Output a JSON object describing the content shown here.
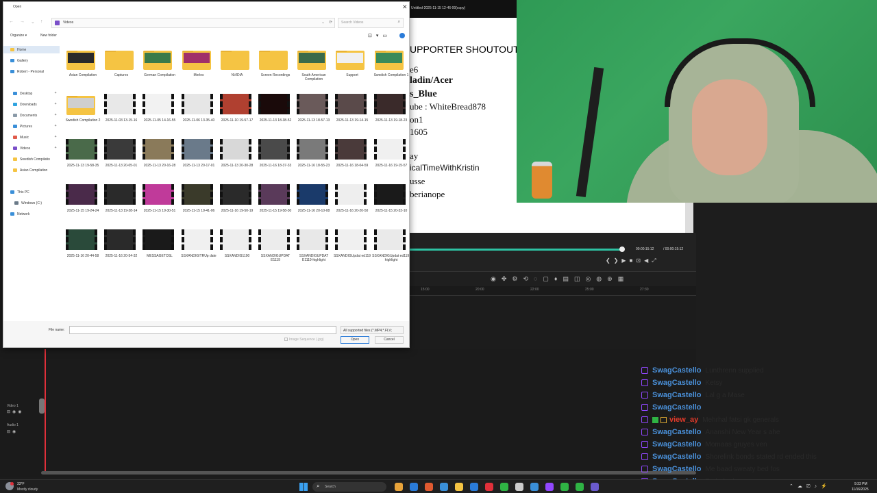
{
  "editor": {
    "title": "Untitled-2025-11-15 12-46-00(copy)",
    "timecode_current": "00:00:15:12",
    "timecode_total": "/ 00:00:15:12",
    "ruler_labels": [
      "15:00",
      "20:00",
      "22:00",
      "25:00",
      "27:30"
    ],
    "tracks": {
      "video": "Video 1",
      "audio": "Audio 1"
    }
  },
  "preview": {
    "title": "UPPORTER SHOUTOUT!",
    "lines": [
      "e6",
      "ladin/Acer",
      "s_Blue",
      "ube : WhiteBread878",
      "on1",
      "1605",
      "ay",
      "icalTimeWithKristin",
      "usse",
      "berianope"
    ]
  },
  "chat": {
    "user_color": "#4a90d9",
    "messages": [
      {
        "user": "SwagCastello",
        "text": "Lunthrenn supplied",
        "color": "#4a90d9"
      },
      {
        "user": "SwagCastello",
        "text": "Ketsy",
        "color": "#4a90d9"
      },
      {
        "user": "SwagCastello",
        "text": "Lal g a Mase",
        "color": "#4a90d9"
      },
      {
        "user": "SwagCastello",
        "text": "",
        "color": "#4a90d9"
      },
      {
        "user": "view_ay",
        "text": "Mehrhal fatsi gk generals",
        "color": "#e03a2a"
      },
      {
        "user": "SwagCastello",
        "text": "Ananshi New Year s ahe",
        "color": "#4a90d9"
      },
      {
        "user": "SwagCastello",
        "text": "Momaas gruyes ven",
        "color": "#4a90d9"
      },
      {
        "user": "SwagCastello",
        "text": "Shorelink bonds stated rd ended this",
        "color": "#4a90d9"
      },
      {
        "user": "SwagCastello",
        "text": "Me baad sweaty bed fos",
        "color": "#4a90d9"
      },
      {
        "user": "SwagCastello",
        "text": "Pe hal ade",
        "color": "#4a90d9"
      }
    ]
  },
  "dialog": {
    "title": "Open",
    "address": "Videos",
    "search_placeholder": "Search Videos",
    "organize": "Organize ▾",
    "new_folder": "New folder",
    "nav": [
      {
        "label": "Home",
        "icon_color": "#f5c443",
        "selected": true,
        "pinned": false
      },
      {
        "label": "Gallery",
        "icon_color": "#3a8fd8",
        "selected": false,
        "pinned": false
      },
      {
        "label": "Robert - Personal",
        "icon_color": "#3a8fd8",
        "selected": false,
        "pinned": false
      },
      {
        "label": "Desktop",
        "icon_color": "#3a8fd8",
        "selected": false,
        "pinned": true
      },
      {
        "label": "Downloads",
        "icon_color": "#2fa3e0",
        "selected": false,
        "pinned": true
      },
      {
        "label": "Documents",
        "icon_color": "#8a9aa8",
        "selected": false,
        "pinned": true
      },
      {
        "label": "Pictures",
        "icon_color": "#3a8fd8",
        "selected": false,
        "pinned": true
      },
      {
        "label": "Music",
        "icon_color": "#e05a4a",
        "selected": false,
        "pinned": true
      },
      {
        "label": "Videos",
        "icon_color": "#7a4fc9",
        "selected": false,
        "pinned": true
      },
      {
        "label": "Swedish Compilatio",
        "icon_color": "#f5c443",
        "selected": false,
        "pinned": false
      },
      {
        "label": "Asian Compilation",
        "icon_color": "#f5c443",
        "selected": false,
        "pinned": false
      },
      {
        "label": "This PC",
        "icon_color": "#3a8fd8",
        "selected": false,
        "pinned": false
      },
      {
        "label": "Windows (C:)",
        "icon_color": "#6a7a88",
        "selected": false,
        "pinned": false
      },
      {
        "label": "Network",
        "icon_color": "#3a8fd8",
        "selected": false,
        "pinned": false
      }
    ],
    "files": [
      {
        "name": "Asian Compilation",
        "kind": "folder",
        "color": "#2a2a2a"
      },
      {
        "name": "Captures",
        "kind": "folder",
        "color": ""
      },
      {
        "name": "German Compilation",
        "kind": "folder",
        "color": "#3a7a4a"
      },
      {
        "name": "Merles",
        "kind": "folder",
        "color": "#a0306a"
      },
      {
        "name": "NVIDIA",
        "kind": "folder",
        "color": ""
      },
      {
        "name": "Screen Recordings",
        "kind": "folder",
        "color": ""
      },
      {
        "name": "South American Compilation",
        "kind": "folder",
        "color": "#3a6a4a"
      },
      {
        "name": "Support",
        "kind": "folder",
        "color": "#f0f0f0"
      },
      {
        "name": "Swedish Compilation 1",
        "kind": "folder",
        "color": "#3a8a5a"
      },
      {
        "name": "Swedish Compilation 2",
        "kind": "folder",
        "color": "#cfcfcf"
      },
      {
        "name": "2025-11-03 13-15-16",
        "kind": "video",
        "color": "#e8e8e8"
      },
      {
        "name": "2025-11-05 14-16-55",
        "kind": "video",
        "color": "#f2f2f2"
      },
      {
        "name": "2025-11-06 13-35-40",
        "kind": "video",
        "color": "#e6e6e6"
      },
      {
        "name": "2025-11-10 19-57-17",
        "kind": "video",
        "color": "#b04030"
      },
      {
        "name": "2025-11-13 18-38-52",
        "kind": "video",
        "color": "#1a0a0a"
      },
      {
        "name": "2025-11-13 18-57-13",
        "kind": "video",
        "color": "#6a5a5a"
      },
      {
        "name": "2025-11-13 19-14-15",
        "kind": "video",
        "color": "#5a4a4a"
      },
      {
        "name": "2025-11-13 19-18-23",
        "kind": "video",
        "color": "#3a2a2a"
      },
      {
        "name": "2025-11-13 19-58-35",
        "kind": "video",
        "color": "#4a6a4a"
      },
      {
        "name": "2025-11-13 20-05-01",
        "kind": "video",
        "color": "#3a3a3a"
      },
      {
        "name": "2025-11-13 20-16-28",
        "kind": "video",
        "color": "#8a7a5a"
      },
      {
        "name": "2025-11-13 20-17-01",
        "kind": "video",
        "color": "#6a7a8a"
      },
      {
        "name": "2025-11-13 20-30-28",
        "kind": "video",
        "color": "#d8d8d8"
      },
      {
        "name": "2025-11-16 18-37-33",
        "kind": "video",
        "color": "#4a4a4a"
      },
      {
        "name": "2025-11-16 18-55-23",
        "kind": "video",
        "color": "#7a7a7a"
      },
      {
        "name": "2025-11-16 18-04-59",
        "kind": "video",
        "color": "#4a3a3a"
      },
      {
        "name": "2025-11-16 19-15-57",
        "kind": "video",
        "color": "#f0f0f0"
      },
      {
        "name": "2025-11-15 19-24-24",
        "kind": "video",
        "color": "#4a2a4a"
      },
      {
        "name": "2025-11-13 19-28-14",
        "kind": "video",
        "color": "#2a2a2a"
      },
      {
        "name": "2025-11-15 19-30-51",
        "kind": "video",
        "color": "#c03a9a"
      },
      {
        "name": "2025-11-15 19-41-06",
        "kind": "video",
        "color": "#3a3a2a"
      },
      {
        "name": "2025-11-16 19-50-19",
        "kind": "video",
        "color": "#2a2a2a"
      },
      {
        "name": "2025-11-15 19-58-30",
        "kind": "video",
        "color": "#5a3a5a"
      },
      {
        "name": "2025-11-16 20-10-08",
        "kind": "video",
        "color": "#1a3a6a"
      },
      {
        "name": "2025-11-16 20-20-50",
        "kind": "video",
        "color": "#eeeeee"
      },
      {
        "name": "2025-11-15 20-33-10",
        "kind": "video",
        "color": "#1a1a1a"
      },
      {
        "name": "2025-11-16 20-44-58",
        "kind": "video",
        "color": "#2a4a3a"
      },
      {
        "name": "2025-11-16 20-54-32",
        "kind": "video",
        "color": "#2a2a2a"
      },
      {
        "name": "MESSAGETOSL",
        "kind": "video",
        "color": "#1a1a1a"
      },
      {
        "name": "SSXANDIGITRUp date",
        "kind": "video",
        "color": "#f0f0f0"
      },
      {
        "name": "SSXANDIG1190",
        "kind": "video",
        "color": "#eeeeee"
      },
      {
        "name": "SSXANDIGUPDAT E1119",
        "kind": "video",
        "color": "#ececec"
      },
      {
        "name": "SSXANDIGUPDAT E1119-highlight",
        "kind": "video",
        "color": "#e8e8e8"
      },
      {
        "name": "SSXANDIGUpdat ed119",
        "kind": "video",
        "color": "#f0f0f0"
      },
      {
        "name": "SSXANDIGUpdat ed119-highlight",
        "kind": "video",
        "color": "#eaeaea"
      }
    ],
    "file_name_label": "File name:",
    "file_name_value": "",
    "file_type": "All supported files (*.MP4;*.FLV;",
    "image_sequence": "Image Sequence (.jpg)",
    "open_label": "Open",
    "cancel_label": "Cancel"
  },
  "taskbar": {
    "temp": "33°F",
    "weather": "Mostly cloudy",
    "search_label": "Search",
    "apps": [
      "#e8a33a",
      "#2a7bd8",
      "#e05a30",
      "#3a8fd8",
      "#f5c443",
      "#2a7bd8",
      "#e0303a",
      "#2fb344",
      "#cccccc",
      "#3a8fd8",
      "#9147ff",
      "#2fb344",
      "#2fb344",
      "#6a5acd"
    ],
    "time": "9:33 PM",
    "date": "11/16/2025"
  }
}
